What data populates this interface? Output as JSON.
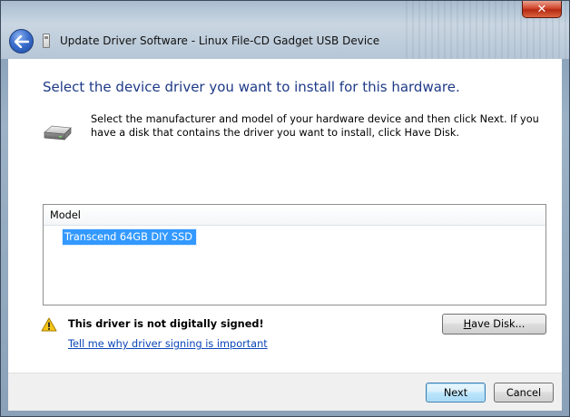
{
  "window": {
    "title": "Update Driver Software - Linux File-CD Gadget USB Device",
    "close_glyph": "✕"
  },
  "main": {
    "heading": "Select the device driver you want to install for this hardware.",
    "instructions": "Select the manufacturer and model of your hardware device and then click Next. If you have a disk that contains the driver you want to install, click Have Disk."
  },
  "model_list": {
    "header": "Model",
    "items": [
      {
        "label": "Transcend 64GB DIY SSD",
        "selected": true
      }
    ]
  },
  "warning": {
    "text": "This driver is not digitally signed!",
    "link": "Tell me why driver signing is important"
  },
  "buttons": {
    "have_disk_mnemonic": "H",
    "have_disk_rest": "ave Disk...",
    "next": "Next",
    "cancel": "Cancel"
  },
  "colors": {
    "heading": "#1e3a87",
    "selection": "#3399ff",
    "link": "#0b46b8",
    "close_button": "#c8401f"
  },
  "icons": {
    "back": "back-arrow-icon",
    "app": "device-manager-icon",
    "hardware": "hard-drive-icon",
    "warning": "warning-triangle-icon",
    "close": "close-icon"
  }
}
